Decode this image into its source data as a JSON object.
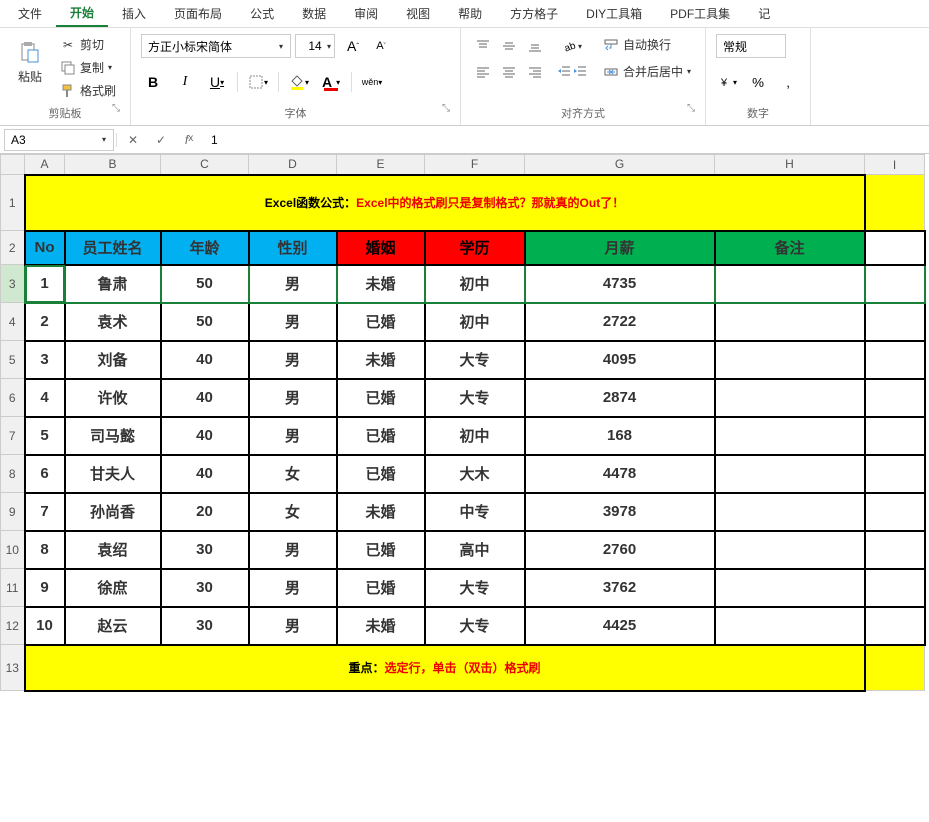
{
  "menu": {
    "items": [
      "文件",
      "开始",
      "插入",
      "页面布局",
      "公式",
      "数据",
      "审阅",
      "视图",
      "帮助",
      "方方格子",
      "DIY工具箱",
      "PDF工具集",
      "记"
    ],
    "active_index": 1
  },
  "ribbon": {
    "clipboard": {
      "paste": "粘贴",
      "cut": "剪切",
      "copy": "复制",
      "format_painter": "格式刷",
      "group": "剪贴板"
    },
    "font": {
      "name": "方正小标宋简体",
      "size": "14",
      "increase_a": "A",
      "decrease_a": "A",
      "bold": "B",
      "italic": "I",
      "underline": "U",
      "pinyin": "wěn",
      "group": "字体"
    },
    "alignment": {
      "wrap_text": "自动换行",
      "merge_center": "合并后居中",
      "group": "对齐方式"
    },
    "number": {
      "format": "常规",
      "percent": "%",
      "comma": ",",
      "group": "数字"
    }
  },
  "formula_bar": {
    "name_box": "A3",
    "formula": "1"
  },
  "sheet": {
    "columns": [
      "A",
      "B",
      "C",
      "D",
      "E",
      "F",
      "G",
      "H",
      "I"
    ],
    "row_labels": [
      "1",
      "2",
      "3",
      "4",
      "5",
      "6",
      "7",
      "8",
      "9",
      "10",
      "11",
      "12",
      "13"
    ],
    "title_prefix": "Excel函数公式：",
    "title_red": "Excel中的格式刷只是复制格式？那就真的Out了！",
    "headers": [
      "No",
      "员工姓名",
      "年龄",
      "性别",
      "婚姻",
      "学历",
      "月薪",
      "备注"
    ],
    "rows": [
      {
        "no": "1",
        "name": "鲁肃",
        "age": "50",
        "sex": "男",
        "marriage": "未婚",
        "edu": "初中",
        "salary": "4735",
        "note": ""
      },
      {
        "no": "2",
        "name": "袁术",
        "age": "50",
        "sex": "男",
        "marriage": "已婚",
        "edu": "初中",
        "salary": "2722",
        "note": ""
      },
      {
        "no": "3",
        "name": "刘备",
        "age": "40",
        "sex": "男",
        "marriage": "未婚",
        "edu": "大专",
        "salary": "4095",
        "note": ""
      },
      {
        "no": "4",
        "name": "许攸",
        "age": "40",
        "sex": "男",
        "marriage": "已婚",
        "edu": "大专",
        "salary": "2874",
        "note": ""
      },
      {
        "no": "5",
        "name": "司马懿",
        "age": "40",
        "sex": "男",
        "marriage": "已婚",
        "edu": "初中",
        "salary": "168",
        "note": ""
      },
      {
        "no": "6",
        "name": "甘夫人",
        "age": "40",
        "sex": "女",
        "marriage": "已婚",
        "edu": "大木",
        "salary": "4478",
        "note": ""
      },
      {
        "no": "7",
        "name": "孙尚香",
        "age": "20",
        "sex": "女",
        "marriage": "未婚",
        "edu": "中专",
        "salary": "3978",
        "note": ""
      },
      {
        "no": "8",
        "name": "袁绍",
        "age": "30",
        "sex": "男",
        "marriage": "已婚",
        "edu": "高中",
        "salary": "2760",
        "note": ""
      },
      {
        "no": "9",
        "name": "徐庶",
        "age": "30",
        "sex": "男",
        "marriage": "已婚",
        "edu": "大专",
        "salary": "3762",
        "note": ""
      },
      {
        "no": "10",
        "name": "赵云",
        "age": "30",
        "sex": "男",
        "marriage": "未婚",
        "edu": "大专",
        "salary": "4425",
        "note": ""
      }
    ],
    "footer_prefix": "重点：",
    "footer_text": "选定行，单击（双击）格式刷",
    "selected_row_index": 0
  }
}
